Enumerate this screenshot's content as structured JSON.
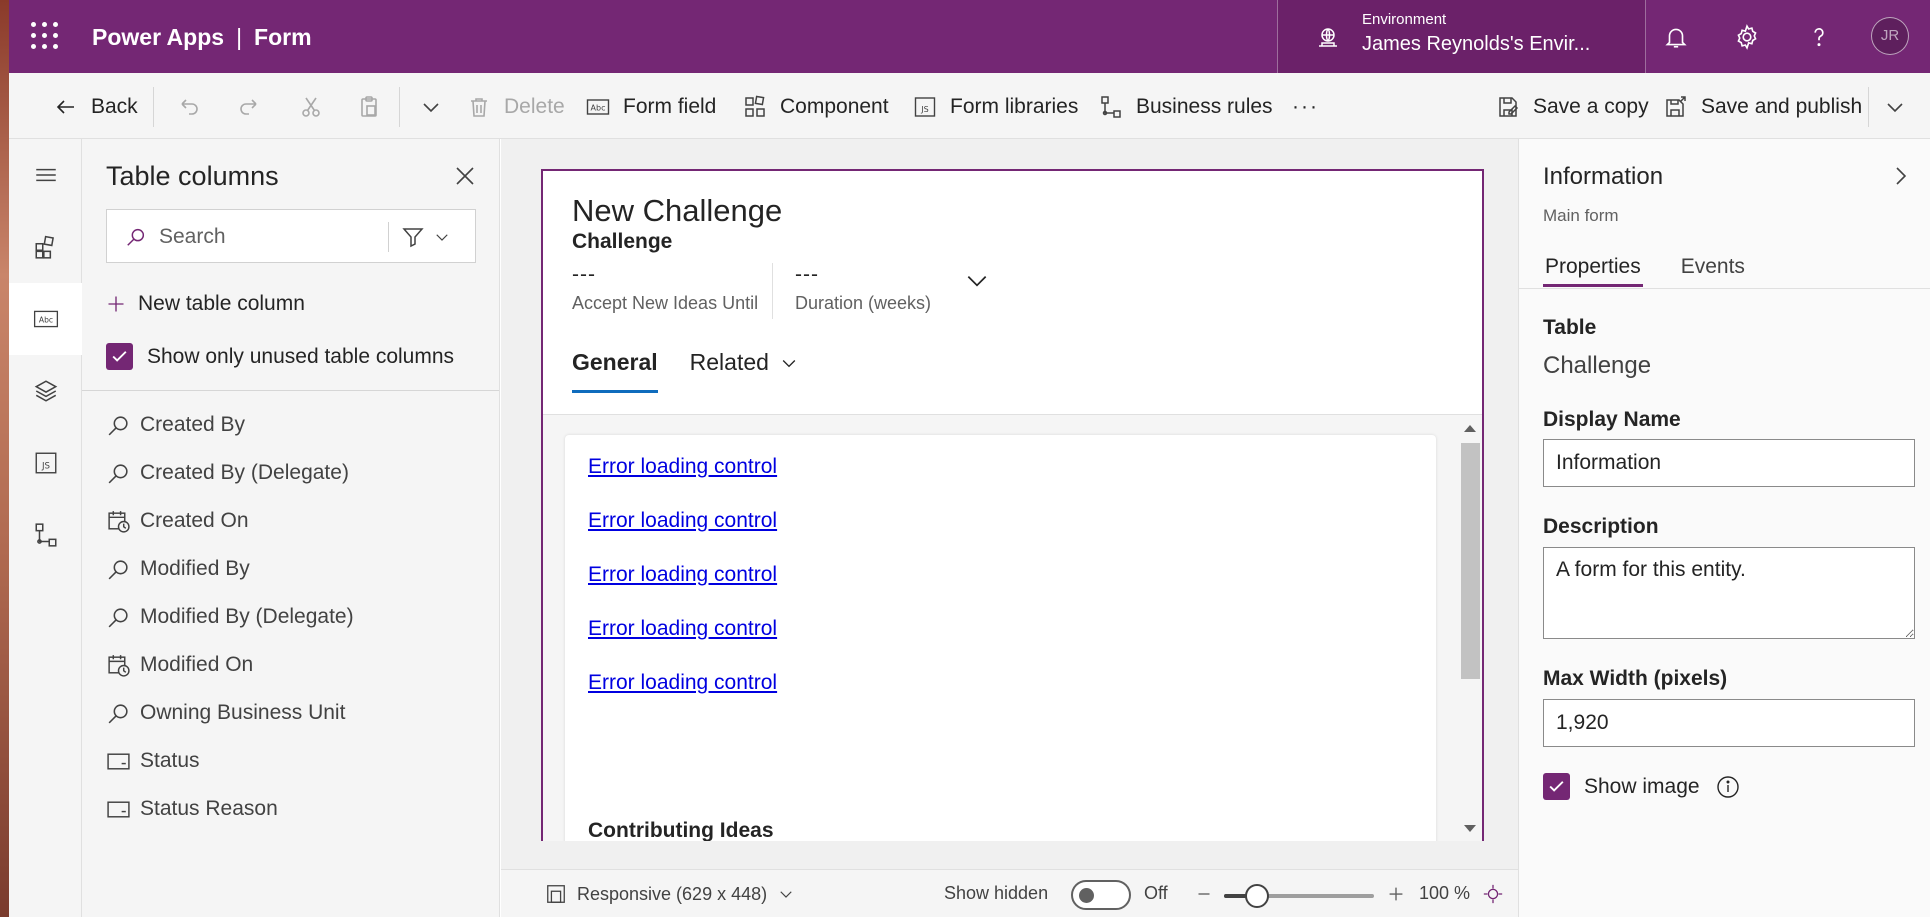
{
  "header": {
    "app_name": "Power Apps",
    "separator": "|",
    "page_name": "Form",
    "environment_label": "Environment",
    "environment_name": "James Reynolds's Envir...",
    "avatar_initials": "JR",
    "brand_color": "#742774"
  },
  "toolbar": {
    "back": "Back",
    "delete": "Delete",
    "form_field": "Form field",
    "component": "Component",
    "form_libraries": "Form libraries",
    "business_rules": "Business rules",
    "more": "···",
    "save_copy": "Save a copy",
    "save_publish": "Save and publish"
  },
  "rail": {
    "items": [
      "hamburger-icon",
      "components-icon",
      "table-columns-icon",
      "tree-view-icon",
      "form-libraries-icon",
      "business-rules-icon"
    ]
  },
  "columns_panel": {
    "title": "Table columns",
    "search_placeholder": "Search",
    "new_column": "New table column",
    "show_unused": "Show only unused table columns",
    "show_unused_checked": true,
    "columns": [
      {
        "label": "Created By",
        "icon": "lookup-icon"
      },
      {
        "label": "Created By (Delegate)",
        "icon": "lookup-icon"
      },
      {
        "label": "Created On",
        "icon": "calendar-clock-icon"
      },
      {
        "label": "Modified By",
        "icon": "lookup-icon"
      },
      {
        "label": "Modified By (Delegate)",
        "icon": "lookup-icon"
      },
      {
        "label": "Modified On",
        "icon": "calendar-clock-icon"
      },
      {
        "label": "Owning Business Unit",
        "icon": "lookup-icon"
      },
      {
        "label": "Status",
        "icon": "option-set-icon"
      },
      {
        "label": "Status Reason",
        "icon": "option-set-icon"
      }
    ]
  },
  "form": {
    "title": "New Challenge",
    "entity": "Challenge",
    "header_fields": [
      {
        "value": "---",
        "label": "Accept New Ideas Until"
      },
      {
        "value": "---",
        "label": "Duration (weeks)"
      }
    ],
    "tabs": [
      "General",
      "Related"
    ],
    "error_links": [
      "Error loading control",
      "Error loading control",
      "Error loading control",
      "Error loading control",
      "Error loading control"
    ],
    "contributing_label": "Contributing Ideas"
  },
  "statusbar": {
    "responsive": "Responsive (629 x 448)",
    "show_hidden": "Show hidden",
    "toggle_state": "Off",
    "zoom": "100 %",
    "zoom_level": 0.22
  },
  "properties": {
    "title": "Information",
    "subtitle": "Main form",
    "tabs": [
      "Properties",
      "Events"
    ],
    "table_label": "Table",
    "table_value": "Challenge",
    "display_name_label": "Display Name",
    "display_name_value": "Information",
    "description_label": "Description",
    "description_value": "A form for this entity.",
    "max_width_label": "Max Width (pixels)",
    "max_width_value": "1,920",
    "show_image": "Show image",
    "show_image_checked": true
  }
}
